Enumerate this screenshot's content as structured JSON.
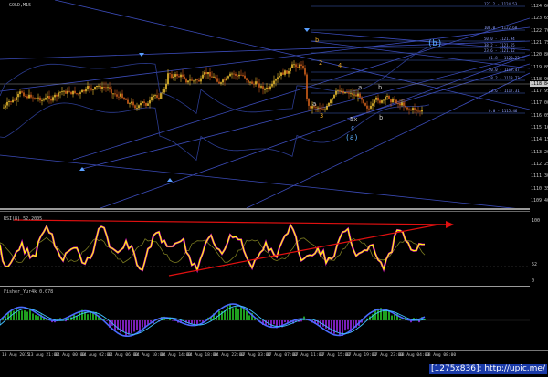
{
  "main_chart": {
    "title": "GOLD,M15",
    "price_levels": [
      "1124.60",
      "1123.65",
      "1122.70",
      "1121.75",
      "1120.80",
      "1119.85",
      "1118.90",
      "1117.95",
      "1117.00",
      "1116.05",
      "1115.10",
      "1114.15",
      "1113.20",
      "1112.25",
      "1111.30",
      "1110.35",
      "1109.40"
    ],
    "current_price": "1118.84",
    "fib_labels": [
      "127.2 - 1124.53",
      "100.0 - 1122.68",
      "50.0 - 1121.94",
      "38.2 - 1121.55",
      "23.6 - 1121.12",
      "61.8 - 1120.22",
      "50.0 - 1119.47",
      "38.2 - 1118.73",
      "23.6 - 1117.31",
      "0.0 - 1115.46"
    ],
    "wave_labels": [
      "b",
      "2",
      "4",
      "a",
      "3",
      "5x",
      "c",
      "b",
      "a",
      "b"
    ],
    "wave_circled": [
      "(b)",
      "(a)"
    ]
  },
  "rsi": {
    "title": "RSI(8) 52.2005",
    "levels": [
      "100",
      "52",
      "0"
    ]
  },
  "fisher": {
    "title": "Fisher_Yur4k 0.078"
  },
  "time_axis": [
    "13 Aug 2015",
    "13 Aug 21:00",
    "14 Aug 00:00",
    "14 Aug 02:00",
    "14 Aug 06:00",
    "14 Aug 10:00",
    "14 Aug 14:00",
    "14 Aug 18:00",
    "14 Aug 22:00",
    "17 Aug 03:00",
    "17 Aug 07:00",
    "17 Aug 11:00",
    "17 Aug 15:00",
    "17 Aug 19:00",
    "17 Aug 23:00",
    "18 Aug 04:00",
    "18 Aug 08:00"
  ],
  "watermark": "[1275x836]: http://upic.me/",
  "colors": {
    "background": "#000000",
    "bull_candle": "#f4c430",
    "bear_candle": "#d2601a",
    "trendline": "#3b4bb8",
    "rsi_line": "#ffff00",
    "rsi_signal": "#ff00ff",
    "red_trend": "#e01010",
    "fib_line": "#4060c0",
    "histogram_up": "#1fa01f",
    "histogram_down": "#7a1fb8",
    "fisher_blue": "#4a6cff",
    "fisher_cyan": "#40c0ff"
  }
}
